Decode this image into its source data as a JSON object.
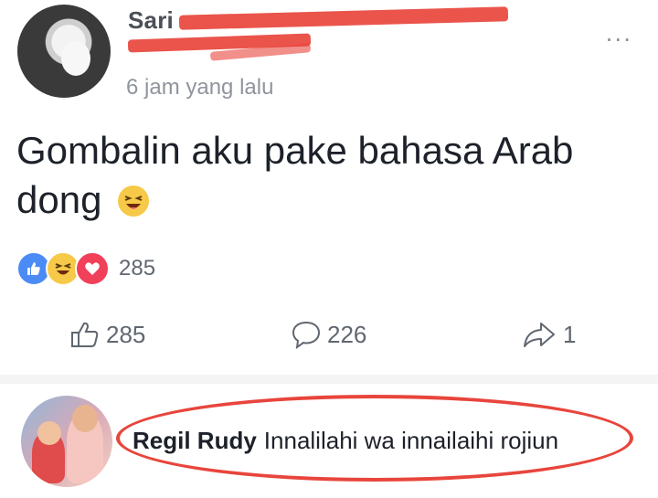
{
  "post": {
    "author_name": "Sari",
    "time": "6 jam yang lalu",
    "more": "...",
    "text_line1": "Gombalin aku pake bahasa Arab",
    "text_line2": "dong"
  },
  "reactions": {
    "types": [
      "like-icon",
      "haha-icon",
      "love-icon"
    ],
    "count": "285"
  },
  "actions": {
    "like_count": "285",
    "comment_count": "226",
    "share_count": "1"
  },
  "comment": {
    "author": "Regil Rudy",
    "text": "Innalilahi wa innailaihi rojiun"
  },
  "colors": {
    "redaction": "#e8453c",
    "highlight_oval": "#e8453c",
    "like_blue": "#4b8bf5",
    "love_red": "#f0405a",
    "haha_yellow": "#f7c948"
  }
}
